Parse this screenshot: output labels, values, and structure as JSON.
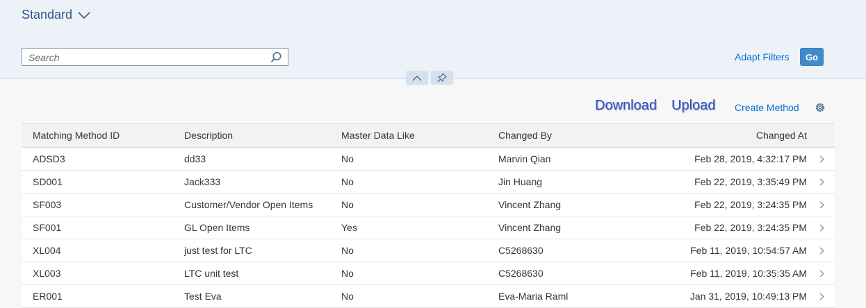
{
  "header": {
    "variant_label": "Standard",
    "search": {
      "placeholder": "Search",
      "value": ""
    },
    "adapt_filters_label": "Adapt Filters",
    "go_label": "Go"
  },
  "toolbar": {
    "download_label": "Download",
    "upload_label": "Upload",
    "create_method_label": "Create Method"
  },
  "table": {
    "columns": [
      "Matching Method ID",
      "Description",
      "Master Data Like",
      "Changed By",
      "Changed At"
    ],
    "rows": [
      [
        "ADSD3",
        "dd33",
        "No",
        "Marvin Qian",
        "Feb 28, 2019, 4:32:17 PM"
      ],
      [
        "SD001",
        "Jack333",
        "No",
        "Jin Huang",
        "Feb 22, 2019, 3:35:49 PM"
      ],
      [
        "SF003",
        "Customer/Vendor Open Items",
        "No",
        "Vincent Zhang",
        "Feb 22, 2019, 3:24:35 PM"
      ],
      [
        "SF001",
        "GL Open Items",
        "Yes",
        "Vincent Zhang",
        "Feb 22, 2019, 3:24:35 PM"
      ],
      [
        "XL004",
        "just test for LTC",
        "No",
        "C5268630",
        "Feb 11, 2019, 10:54:57 AM"
      ],
      [
        "XL003",
        "LTC unit test",
        "No",
        "C5268630",
        "Feb 11, 2019, 10:35:35 AM"
      ],
      [
        "ER001",
        "Test Eva",
        "No",
        "Eva-Maria Raml",
        "Jan 31, 2019, 10:49:13 PM"
      ]
    ]
  },
  "colors": {
    "header_bg": "#edf2f8",
    "link": "#0a6ed1",
    "emphasized_button": "#428bca",
    "variant_title": "#32578a"
  }
}
